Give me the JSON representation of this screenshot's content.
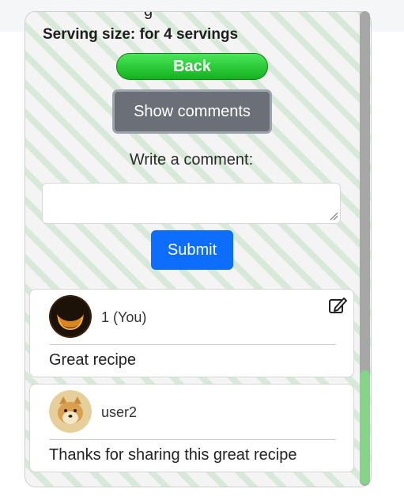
{
  "recipe": {
    "serving_size_text": "Serving size: for 4 servings"
  },
  "actions": {
    "back_label": "Back",
    "show_comments_label": "Show comments",
    "write_comment_label": "Write a comment:",
    "comment_input_value": "",
    "comment_input_placeholder": "",
    "submit_label": "Submit"
  },
  "comments": [
    {
      "username": "1 (You)",
      "text": "Great recipe",
      "avatar_icon": "dark-crescent-avatar",
      "editable": true
    },
    {
      "username": "user2",
      "text": "Thanks for sharing this great recipe",
      "avatar_icon": "shiba-dog-avatar",
      "editable": false
    }
  ],
  "colors": {
    "back_button": "#1fc22c",
    "show_comments_button": "#6b7078",
    "submit_button": "#0d6efd",
    "stripe": "#d7e9d9",
    "scroll_thumb": "#86d48a"
  }
}
